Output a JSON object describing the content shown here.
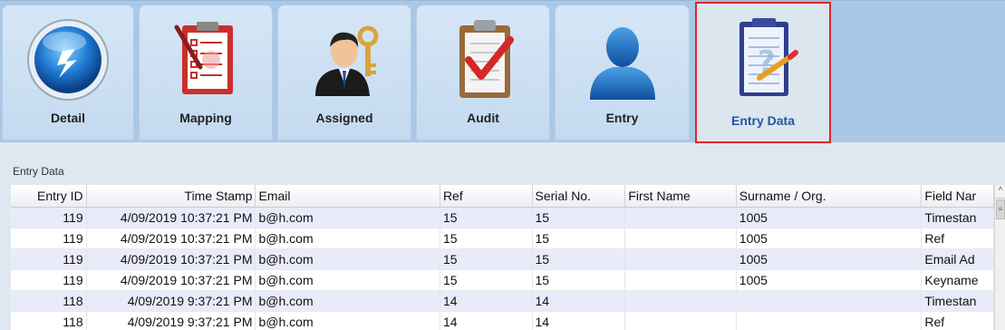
{
  "tabs": [
    {
      "label": "Detail",
      "icon": "lightning-orb-icon",
      "active": false
    },
    {
      "label": "Mapping",
      "icon": "clipboard-checklist-icon",
      "active": false
    },
    {
      "label": "Assigned",
      "icon": "user-key-icon",
      "active": false
    },
    {
      "label": "Audit",
      "icon": "clipboard-checkmark-icon",
      "active": false
    },
    {
      "label": "Entry",
      "icon": "user-silhouette-icon",
      "active": false
    },
    {
      "label": "Entry Data",
      "icon": "clipboard-question-icon",
      "active": true
    }
  ],
  "section_label": "Entry Data",
  "table": {
    "columns": [
      "Entry ID",
      "Time Stamp",
      "Email",
      "Ref",
      "Serial No.",
      "First Name",
      "Surname / Org.",
      "Field Nar"
    ],
    "rows": [
      [
        "119",
        "4/09/2019 10:37:21 PM",
        "b@h.com",
        "15",
        "15",
        "",
        "1005",
        "Timestan"
      ],
      [
        "119",
        "4/09/2019 10:37:21 PM",
        "b@h.com",
        "15",
        "15",
        "",
        "1005",
        "Ref"
      ],
      [
        "119",
        "4/09/2019 10:37:21 PM",
        "b@h.com",
        "15",
        "15",
        "",
        "1005",
        "Email Ad"
      ],
      [
        "119",
        "4/09/2019 10:37:21 PM",
        "b@h.com",
        "15",
        "15",
        "",
        "1005",
        "Keyname"
      ],
      [
        "118",
        "4/09/2019 9:37:21 PM",
        "b@h.com",
        "14",
        "14",
        "",
        "",
        "Timestan"
      ],
      [
        "118",
        "4/09/2019 9:37:21 PM",
        "b@h.com",
        "14",
        "14",
        "",
        "",
        "Ref"
      ]
    ]
  },
  "colors": {
    "toolbar_bg": "#a9c8e7",
    "active_border": "#e0232b",
    "active_label": "#2456a6",
    "alt_row": "#e9ebfb"
  }
}
